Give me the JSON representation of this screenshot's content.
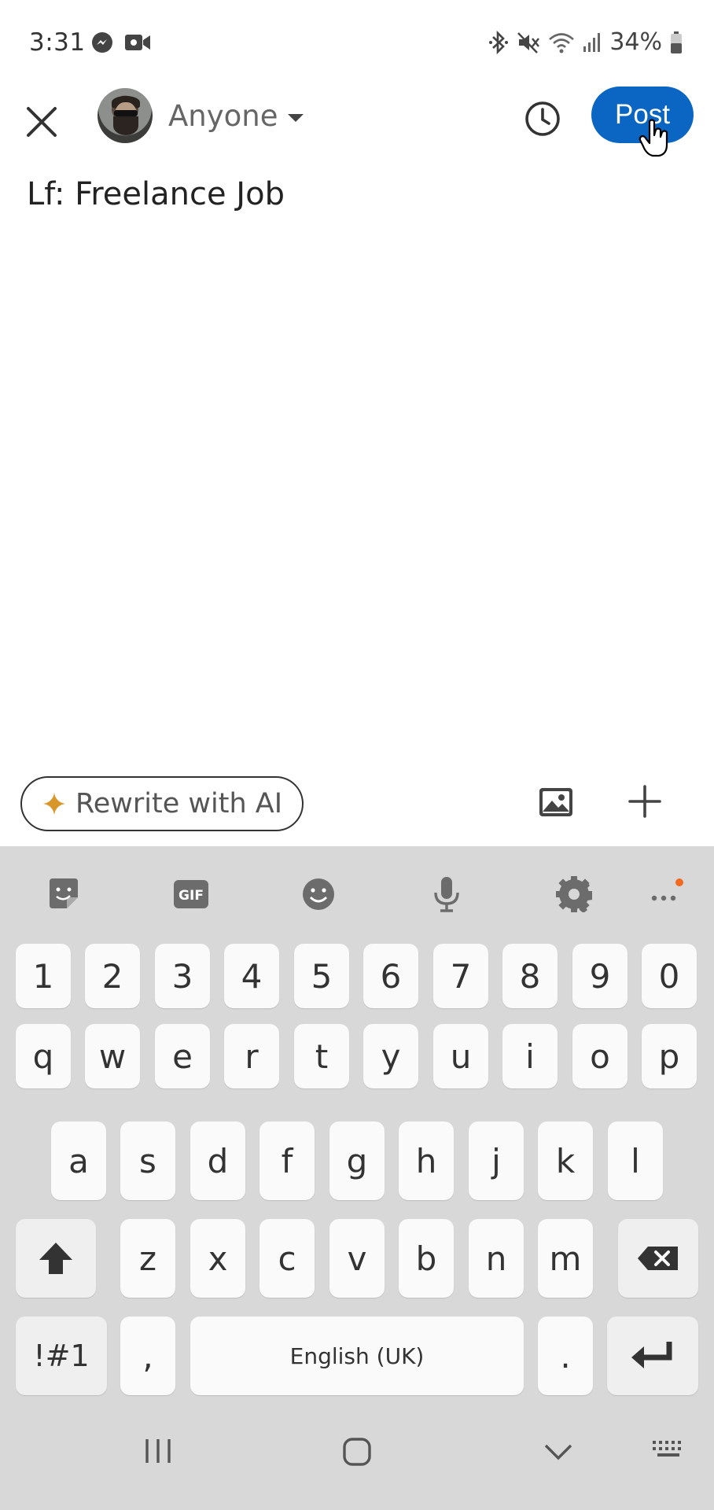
{
  "status_bar": {
    "time": "3:31",
    "battery": "34%",
    "left_icons": [
      "messenger-icon",
      "video-call-icon"
    ],
    "right_icons": [
      "bluetooth-icon",
      "mute-icon",
      "wifi-icon",
      "signal-icon",
      "battery-icon"
    ]
  },
  "header": {
    "audience_label": "Anyone",
    "post_label": "Post"
  },
  "compose": {
    "text": "Lf: Freelance Job"
  },
  "tools": {
    "rewrite_label": "Rewrite with AI"
  },
  "keyboard": {
    "toolbar": [
      "sticker-icon",
      "gif-icon",
      "emoji-icon",
      "microphone-icon",
      "settings-icon",
      "more-icon"
    ],
    "number_row": [
      "1",
      "2",
      "3",
      "4",
      "5",
      "6",
      "7",
      "8",
      "9",
      "0"
    ],
    "row1": [
      "q",
      "w",
      "e",
      "r",
      "t",
      "y",
      "u",
      "i",
      "o",
      "p"
    ],
    "row2": [
      "a",
      "s",
      "d",
      "f",
      "g",
      "h",
      "j",
      "k",
      "l"
    ],
    "row3": [
      "z",
      "x",
      "c",
      "v",
      "b",
      "n",
      "m"
    ],
    "symbols_label": "!#1",
    "comma_label": ",",
    "space_label": "English (UK)",
    "period_label": "."
  },
  "colors": {
    "accent": "#0a66c2",
    "keyboard_bg": "#d8d8d8",
    "key_bg": "#fafafa",
    "ai_sparkle": "#d9972b",
    "notification_dot": "#f26b1d"
  }
}
